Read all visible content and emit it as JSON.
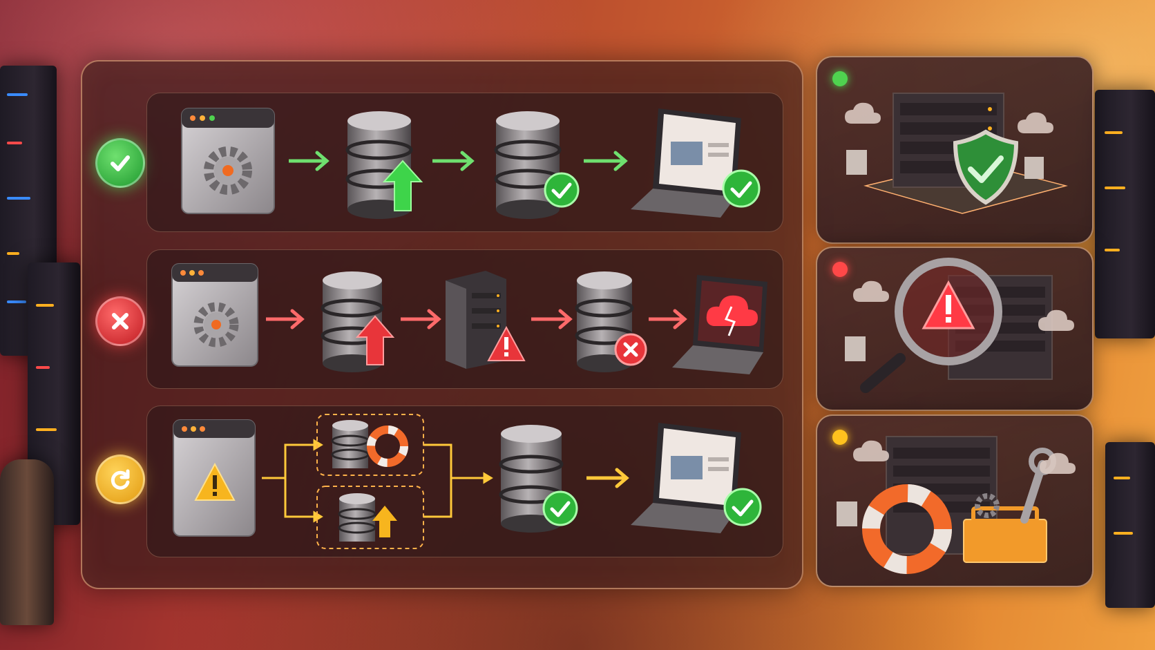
{
  "diagram": {
    "rows": [
      {
        "status": "success",
        "status_icon": "check-icon",
        "color": "#4fdc5a",
        "steps": [
          "settings-window-icon",
          "database-upload-icon",
          "database-verified-icon",
          "laptop-success-icon"
        ]
      },
      {
        "status": "failure",
        "status_icon": "x-icon",
        "color": "#ff5a5a",
        "steps": [
          "settings-window-icon",
          "database-upload-icon",
          "server-warning-icon",
          "database-error-icon",
          "laptop-broken-cloud-icon"
        ]
      },
      {
        "status": "recovery",
        "status_icon": "refresh-icon",
        "color": "#ffc93a",
        "steps": [
          "warning-window-icon",
          "database-lifebuoy-icon",
          "database-upload-icon",
          "database-verified-icon",
          "laptop-success-icon"
        ]
      }
    ],
    "cards": [
      {
        "indicator": "green",
        "icon": "server-shield-icon"
      },
      {
        "indicator": "red",
        "icon": "server-magnifier-warning-icon"
      },
      {
        "indicator": "yellow",
        "icon": "server-lifebuoy-toolbox-icon"
      }
    ]
  }
}
